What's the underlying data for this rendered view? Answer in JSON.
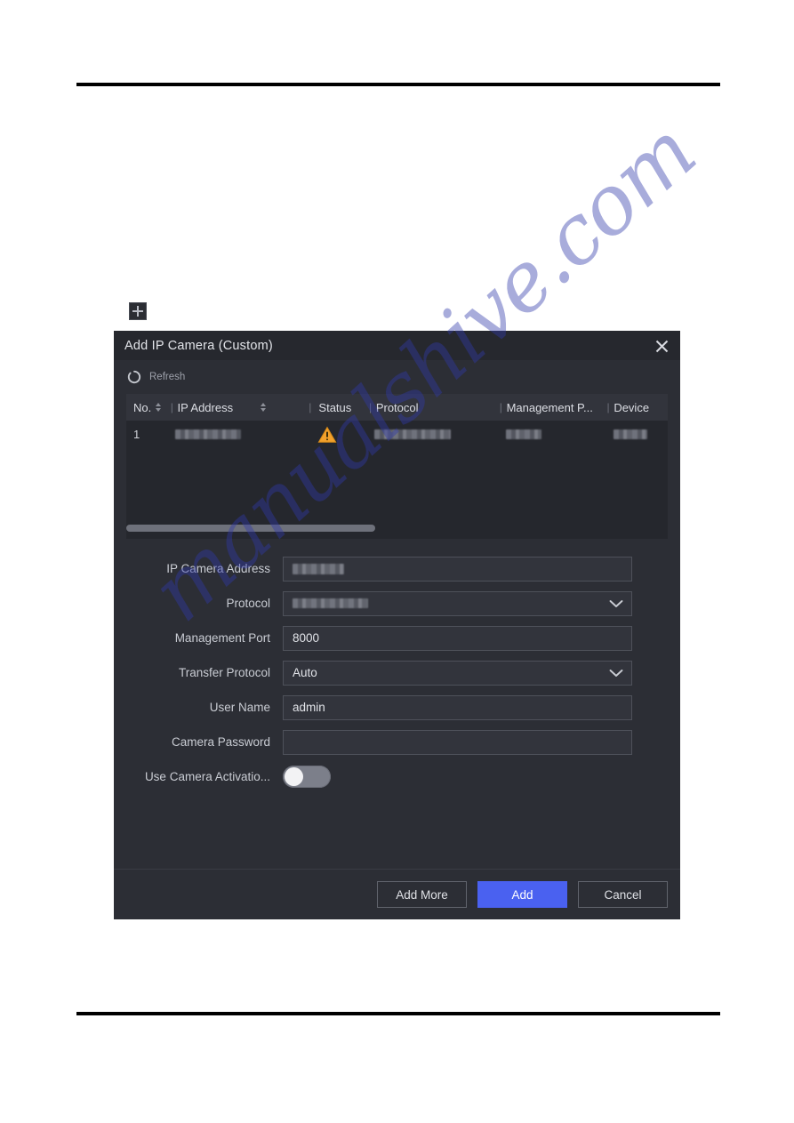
{
  "page": {
    "background": "#ffffff",
    "rule_color": "#000000"
  },
  "add_button": {
    "icon": "plus-icon",
    "tooltip": "Add"
  },
  "watermark": {
    "text": "manualshive.com",
    "color": "#303aaa"
  },
  "dialog": {
    "title": "Add IP Camera (Custom)",
    "close_icon": "close-icon",
    "background": "#2c2e35",
    "accent": "#4a61f0",
    "toolbar": {
      "refresh_label": "Refresh",
      "refresh_icon": "refresh-icon"
    },
    "table": {
      "columns": [
        {
          "key": "no",
          "label": "No.",
          "sortable": true
        },
        {
          "key": "ip_address",
          "label": "IP Address",
          "sortable": true
        },
        {
          "key": "status",
          "label": "Status",
          "sortable": false
        },
        {
          "key": "protocol",
          "label": "Protocol",
          "sortable": false
        },
        {
          "key": "management_port",
          "label": "Management P...",
          "sortable": false
        },
        {
          "key": "device_model",
          "label": "Device",
          "sortable": false,
          "truncated": true
        }
      ],
      "separator": "|",
      "rows": [
        {
          "no": "1",
          "ip_address": "",
          "ip_address_redacted": true,
          "status": "",
          "status_icon": "warning-triangle-icon",
          "status_color": "#f0a028",
          "protocol": "",
          "protocol_redacted": true,
          "management_port": "",
          "management_port_redacted": true,
          "device_model": "",
          "device_model_redacted": true
        }
      ],
      "hscroll": {
        "thumb_percent": 46
      }
    },
    "form": {
      "fields": [
        {
          "name": "ip-camera-address",
          "label": "IP Camera Address",
          "type": "text",
          "value": "",
          "redacted": true,
          "placeholder": ""
        },
        {
          "name": "protocol",
          "label": "Protocol",
          "type": "select",
          "value": "",
          "redacted": true,
          "placeholder": ""
        },
        {
          "name": "management-port",
          "label": "Management Port",
          "type": "text",
          "value": "8000",
          "redacted": false,
          "placeholder": ""
        },
        {
          "name": "transfer-protocol",
          "label": "Transfer Protocol",
          "type": "select",
          "value": "Auto",
          "redacted": false,
          "placeholder": ""
        },
        {
          "name": "user-name",
          "label": "User Name",
          "type": "text",
          "value": "admin",
          "redacted": false,
          "placeholder": ""
        },
        {
          "name": "camera-password",
          "label": "Camera Password",
          "type": "password",
          "value": "",
          "redacted": false,
          "placeholder": ""
        }
      ],
      "toggle": {
        "name": "use-camera-activation-password",
        "label": "Use Camera Activatio...",
        "checked": false
      }
    },
    "footer": {
      "buttons": [
        {
          "name": "add-more-button",
          "label": "Add More",
          "primary": false
        },
        {
          "name": "add-button",
          "label": "Add",
          "primary": true
        },
        {
          "name": "cancel-button",
          "label": "Cancel",
          "primary": false
        }
      ]
    }
  }
}
